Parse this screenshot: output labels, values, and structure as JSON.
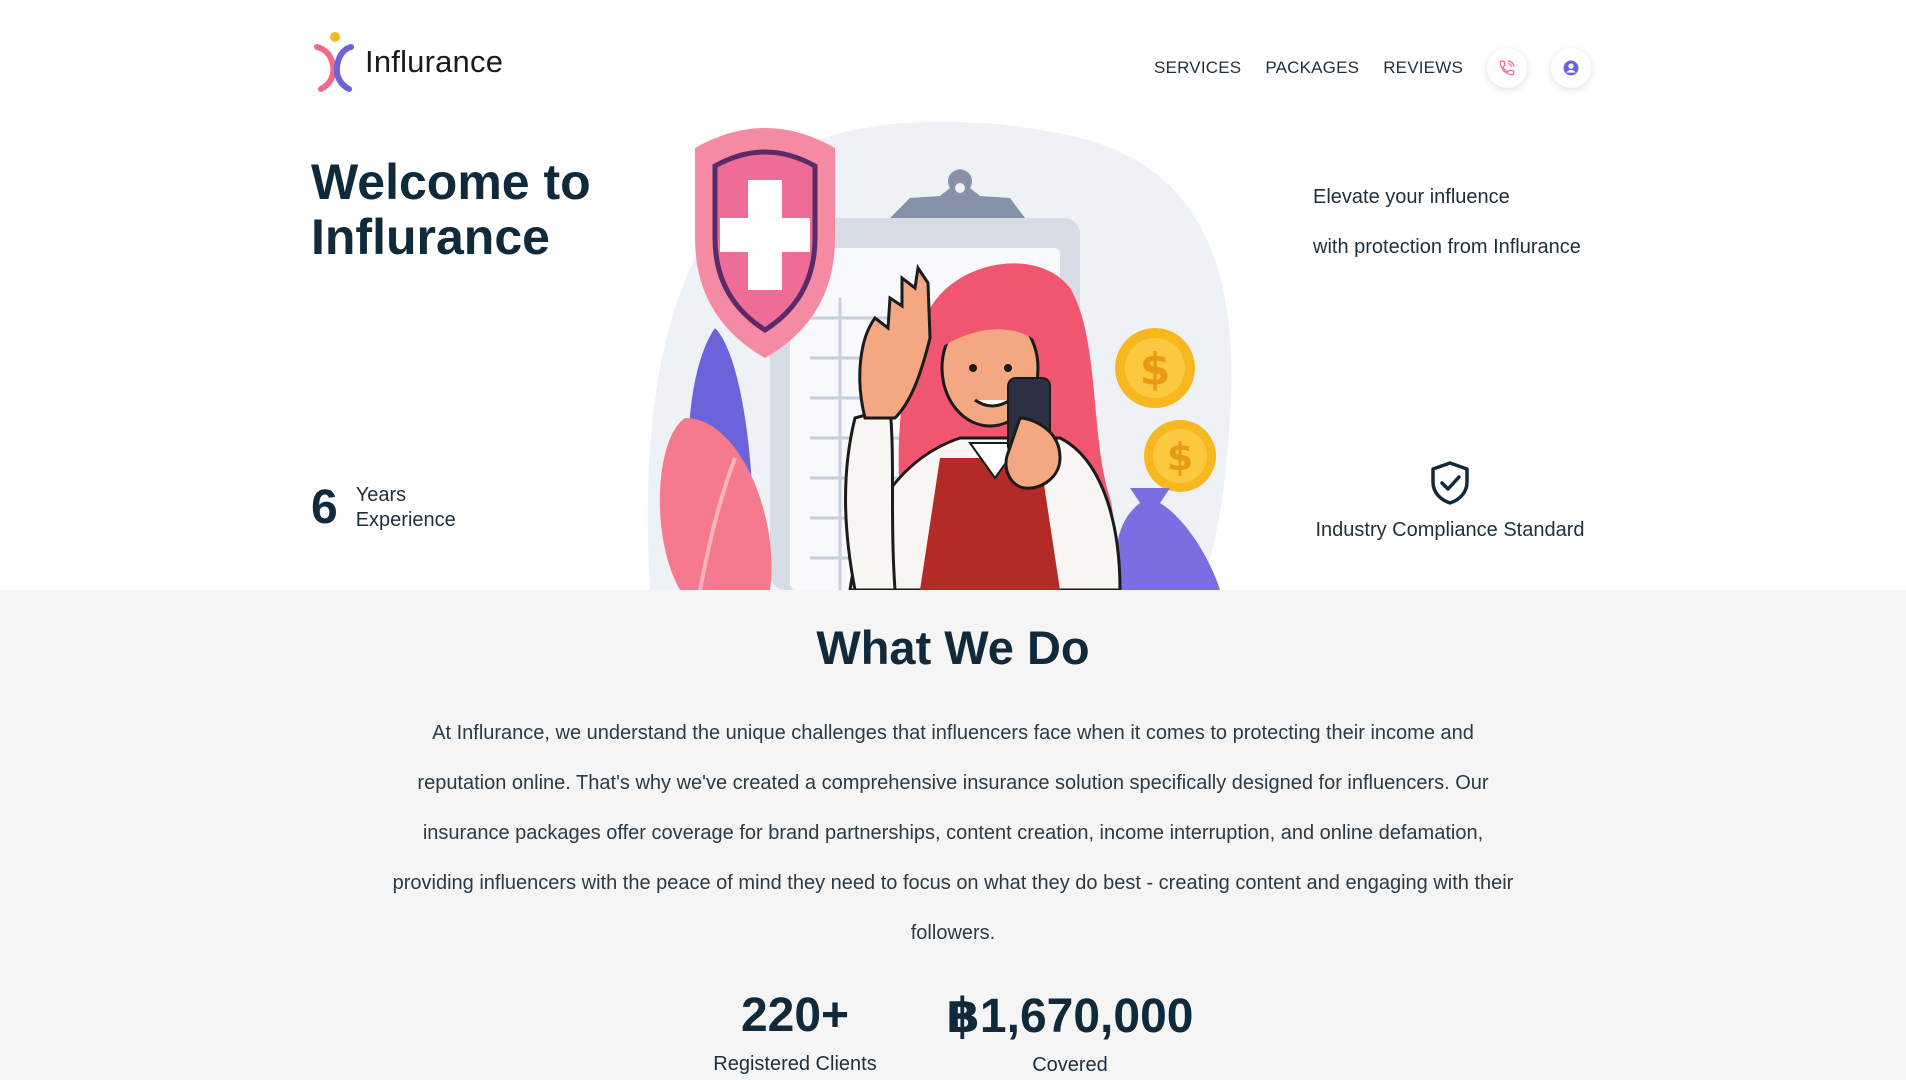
{
  "header": {
    "brand": "Influrance",
    "nav": [
      "SERVICES",
      "PACKAGES",
      "REVIEWS"
    ],
    "icons": [
      "phone-icon",
      "user-icon"
    ]
  },
  "hero": {
    "title_line1": "Welcome to",
    "title_line2": "Influrance",
    "experience_number": "6",
    "experience_line1": "Years",
    "experience_line2": "Experience",
    "tagline_line1": "Elevate your influence",
    "tagline_line2": "with protection from Influrance",
    "compliance": "Industry Compliance Standard"
  },
  "what_we_do": {
    "title": "What We Do",
    "body": "At Influrance, we understand the unique challenges that influencers face when it comes to protecting their income and reputation online. That's why we've created a comprehensive insurance solution specifically designed for influencers. Our insurance packages offer coverage for brand partnerships, content creation, income interruption, and online defamation, providing influencers with the peace of mind they need to focus on what they do best - creating content and engaging with their followers."
  },
  "stats": [
    {
      "value": "220+",
      "label": "Registered Clients"
    },
    {
      "value": "฿1,670,000",
      "label": "Covered"
    }
  ],
  "colors": {
    "primary_text": "#10293b",
    "accent_pink": "#f06a8a",
    "accent_purple": "#6b63d9",
    "coin": "#f7b71e"
  }
}
